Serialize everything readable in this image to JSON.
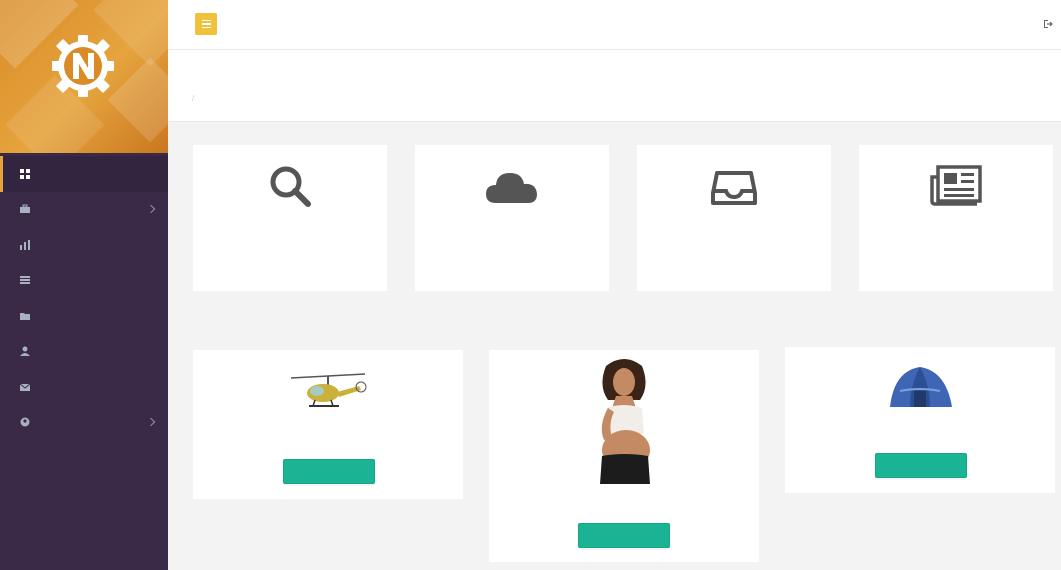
{
  "app": {
    "logo_icon": "gear-n-logo-icon",
    "brand_colors": {
      "header_orange": "#e6a43e",
      "sidebar": "#3a2a47",
      "accent_green": "#1ab394",
      "menu_button_yellow": "#f0c13a"
    }
  },
  "sidebar": {
    "profile_name": "",
    "profile_role": "",
    "items": [
      {
        "label": "",
        "icon": "dashboard-icon",
        "active": true,
        "has_arrow": false
      },
      {
        "label": "",
        "icon": "briefcase-icon",
        "active": false,
        "has_arrow": true
      },
      {
        "label": "",
        "icon": "chart-icon",
        "active": false,
        "has_arrow": false
      },
      {
        "label": "",
        "icon": "list-icon",
        "active": false,
        "has_arrow": false
      },
      {
        "label": "",
        "icon": "folder-icon",
        "active": false,
        "has_arrow": false
      },
      {
        "label": "",
        "icon": "user-icon",
        "active": false,
        "has_arrow": false
      },
      {
        "label": "",
        "icon": "envelope-icon",
        "active": false,
        "has_arrow": false
      },
      {
        "label": "",
        "icon": "account-icon",
        "active": false,
        "has_arrow": true
      }
    ]
  },
  "topbar": {
    "menu_icon": "hamburger-icon",
    "welcome_text": "",
    "logout_label": "",
    "logout_icon": "sign-out-icon"
  },
  "page_heading": {
    "title": "",
    "breadcrumb_home": "",
    "breadcrumb_current": ""
  },
  "stats": [
    {
      "icon": "search-icon",
      "value": "",
      "label": ""
    },
    {
      "icon": "cloud-icon",
      "value": "",
      "label": ""
    },
    {
      "icon": "inbox-icon",
      "value": "",
      "label": ""
    },
    {
      "icon": "newspaper-icon",
      "value": "",
      "label": ""
    }
  ],
  "suggestions": {
    "title": "",
    "items": [
      {
        "name": "",
        "category": "",
        "image": "helicopter-icon",
        "button_label": ""
      },
      {
        "name": "",
        "category": "",
        "image": "pregnant-woman-photo",
        "button_label": ""
      },
      {
        "name": "",
        "category": "",
        "image": "tent-icon",
        "button_label": ""
      }
    ]
  }
}
